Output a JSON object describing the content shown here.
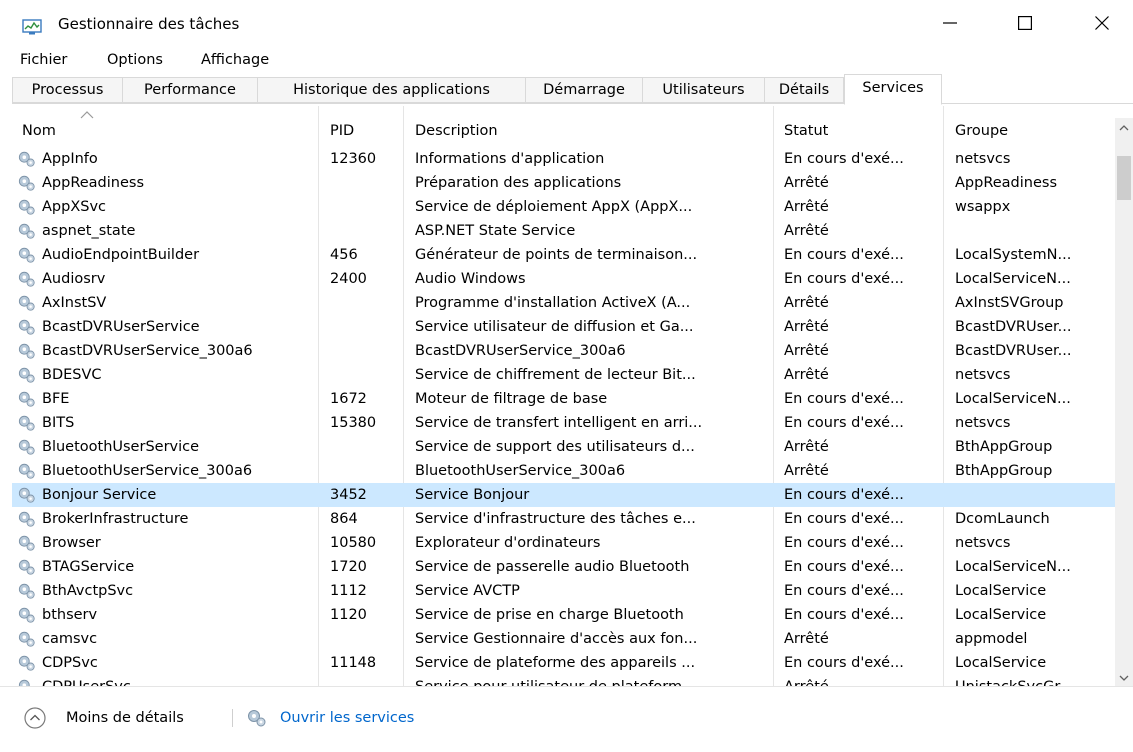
{
  "window": {
    "title": "Gestionnaire des tâches",
    "controls": {
      "minimize": "minimize-icon",
      "maximize": "maximize-icon",
      "close": "close-icon"
    }
  },
  "menu": [
    "Fichier",
    "Options",
    "Affichage"
  ],
  "tabs": [
    {
      "label": "Processus",
      "active": false
    },
    {
      "label": "Performance",
      "active": false
    },
    {
      "label": "Historique des applications",
      "active": false
    },
    {
      "label": "Démarrage",
      "active": false
    },
    {
      "label": "Utilisateurs",
      "active": false
    },
    {
      "label": "Détails",
      "active": false
    },
    {
      "label": "Services",
      "active": true
    }
  ],
  "table": {
    "columns": [
      "Nom",
      "PID",
      "Description",
      "Statut",
      "Groupe"
    ],
    "sort_column": "Nom",
    "rows": [
      {
        "name": "AppInfo",
        "pid": "12360",
        "description": "Informations d'application",
        "status": "En cours d'exé...",
        "group": "netsvcs"
      },
      {
        "name": "AppReadiness",
        "pid": "",
        "description": "Préparation des applications",
        "status": "Arrêté",
        "group": "AppReadiness"
      },
      {
        "name": "AppXSvc",
        "pid": "",
        "description": "Service de déploiement AppX (AppX...",
        "status": "Arrêté",
        "group": "wsappx"
      },
      {
        "name": "aspnet_state",
        "pid": "",
        "description": "ASP.NET State Service",
        "status": "Arrêté",
        "group": ""
      },
      {
        "name": "AudioEndpointBuilder",
        "pid": "456",
        "description": "Générateur de points de terminaison...",
        "status": "En cours d'exé...",
        "group": "LocalSystemN..."
      },
      {
        "name": "Audiosrv",
        "pid": "2400",
        "description": "Audio Windows",
        "status": "En cours d'exé...",
        "group": "LocalServiceN..."
      },
      {
        "name": "AxInstSV",
        "pid": "",
        "description": "Programme d'installation ActiveX (A...",
        "status": "Arrêté",
        "group": "AxInstSVGroup"
      },
      {
        "name": "BcastDVRUserService",
        "pid": "",
        "description": "Service utilisateur de diffusion et Ga...",
        "status": "Arrêté",
        "group": "BcastDVRUser..."
      },
      {
        "name": "BcastDVRUserService_300a6",
        "pid": "",
        "description": "BcastDVRUserService_300a6",
        "status": "Arrêté",
        "group": "BcastDVRUser..."
      },
      {
        "name": "BDESVC",
        "pid": "",
        "description": "Service de chiffrement de lecteur Bit...",
        "status": "Arrêté",
        "group": "netsvcs"
      },
      {
        "name": "BFE",
        "pid": "1672",
        "description": "Moteur de filtrage de base",
        "status": "En cours d'exé...",
        "group": "LocalServiceN..."
      },
      {
        "name": "BITS",
        "pid": "15380",
        "description": "Service de transfert intelligent en arri...",
        "status": "En cours d'exé...",
        "group": "netsvcs"
      },
      {
        "name": "BluetoothUserService",
        "pid": "",
        "description": "Service de support des utilisateurs d...",
        "status": "Arrêté",
        "group": "BthAppGroup"
      },
      {
        "name": "BluetoothUserService_300a6",
        "pid": "",
        "description": "BluetoothUserService_300a6",
        "status": "Arrêté",
        "group": "BthAppGroup"
      },
      {
        "name": "Bonjour Service",
        "pid": "3452",
        "description": "Service Bonjour",
        "status": "En cours d'exé...",
        "group": "",
        "selected": true
      },
      {
        "name": "BrokerInfrastructure",
        "pid": "864",
        "description": "Service d'infrastructure des tâches e...",
        "status": "En cours d'exé...",
        "group": "DcomLaunch"
      },
      {
        "name": "Browser",
        "pid": "10580",
        "description": "Explorateur d'ordinateurs",
        "status": "En cours d'exé...",
        "group": "netsvcs"
      },
      {
        "name": "BTAGService",
        "pid": "1720",
        "description": "Service de passerelle audio Bluetooth",
        "status": "En cours d'exé...",
        "group": "LocalServiceN..."
      },
      {
        "name": "BthAvctpSvc",
        "pid": "1112",
        "description": "Service AVCTP",
        "status": "En cours d'exé...",
        "group": "LocalService"
      },
      {
        "name": "bthserv",
        "pid": "1120",
        "description": "Service de prise en charge Bluetooth",
        "status": "En cours d'exé...",
        "group": "LocalService"
      },
      {
        "name": "camsvc",
        "pid": "",
        "description": "Service Gestionnaire d'accès aux fon...",
        "status": "Arrêté",
        "group": "appmodel"
      },
      {
        "name": "CDPSvc",
        "pid": "11148",
        "description": "Service de plateforme des appareils ...",
        "status": "En cours d'exé...",
        "group": "LocalService"
      },
      {
        "name": "CDPUserSvc",
        "pid": "",
        "description": "Service pour utilisateur de plateform...",
        "status": "Arrêté",
        "group": "UnistackSvcGr..."
      }
    ]
  },
  "footer": {
    "fewer_details": "Moins de détails",
    "open_services": "Ouvrir les services"
  },
  "colors": {
    "selected_row": "#cce8ff",
    "link": "#0066cc",
    "tab_inactive_bg": "#f5f5f5",
    "border": "#d9d9d9"
  }
}
